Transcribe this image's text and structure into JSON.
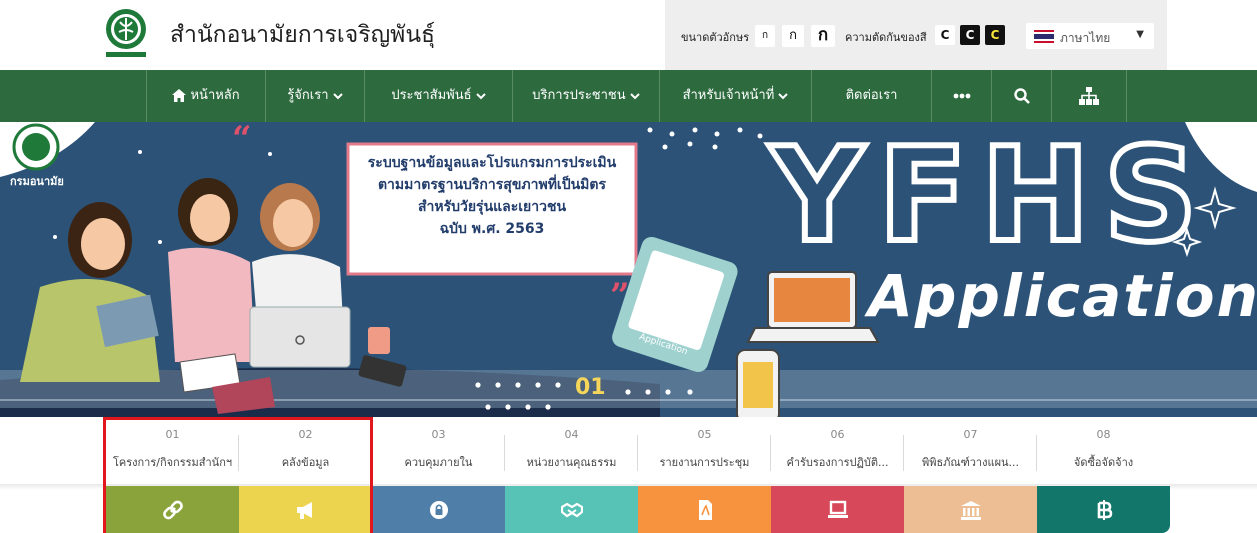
{
  "header": {
    "site_title": "สำนักอนามัยการเจริญพันธุ์",
    "logo_icon": "department-of-health-logo"
  },
  "toolbox": {
    "font_size_label": "ขนาดตัวอักษร",
    "font_size_buttons": [
      "ก",
      "ก",
      "ก"
    ],
    "contrast_label": "ความตัดกันของสี",
    "contrast_buttons": [
      "C",
      "C",
      "C"
    ],
    "language": "ภาษาไทย",
    "language_flag_icon": "thai-flag-icon"
  },
  "nav": {
    "items": [
      {
        "label": "หน้าหลัก",
        "icon": "home-icon"
      },
      {
        "label": "รู้จักเรา",
        "icon": "chevron-down-icon"
      },
      {
        "label": "ประชาสัมพันธ์",
        "icon": "chevron-down-icon"
      },
      {
        "label": "บริการประชาชน",
        "icon": "chevron-down-icon"
      },
      {
        "label": "สำหรับเจ้าหน้าที่",
        "icon": "chevron-down-icon"
      },
      {
        "label": "ติดต่อเรา"
      },
      {
        "icon": "more-dots-icon"
      },
      {
        "icon": "search-icon"
      },
      {
        "icon": "sitemap-icon"
      }
    ],
    "color": "#2d6b3f"
  },
  "banner": {
    "headline_lines": [
      "ระบบฐานข้อมูลและโปรแกรมการประเมิน",
      "ตามมาตรฐานบริการสุขภาพที่เป็นมิตร",
      "สำหรับวัยรุ่นและเยาวชน",
      "ฉบับ พ.ศ. 2563"
    ],
    "big_title": "YFHS",
    "big_subtitle": "Application",
    "tablet_text": [
      "YFHS",
      "Application"
    ],
    "slide_number": "01",
    "logo_text": "กรมอนามัย",
    "background_color": "#2c5377",
    "accent_color": "#f5d65a"
  },
  "tabs": [
    {
      "num": "01",
      "label": "โครงการ/กิจกรรมสำนักฯ",
      "icon": "link-icon",
      "color": "#8aa33a"
    },
    {
      "num": "02",
      "label": "คลังข้อมูล",
      "icon": "megaphone-icon",
      "color": "#ecd44f"
    },
    {
      "num": "03",
      "label": "ควบคุมภายใน",
      "icon": "lock-icon",
      "color": "#4f7fa8"
    },
    {
      "num": "04",
      "label": "หน่วยงานคุณธรรม",
      "icon": "handshake-icon",
      "color": "#57c2b6"
    },
    {
      "num": "05",
      "label": "รายงานการประชุม",
      "icon": "pdf-file-icon",
      "color": "#f7933f"
    },
    {
      "num": "06",
      "label": "คำรับรองการปฏิบัติ...",
      "icon": "laptop-icon",
      "color": "#d6485a"
    },
    {
      "num": "07",
      "label": "พิพิธภัณฑ์วางแผน...",
      "icon": "museum-icon",
      "color": "#edbd93"
    },
    {
      "num": "08",
      "label": "จัดซื้อจัดจ้าง",
      "icon": "baht-icon",
      "color": "#12766a"
    }
  ]
}
